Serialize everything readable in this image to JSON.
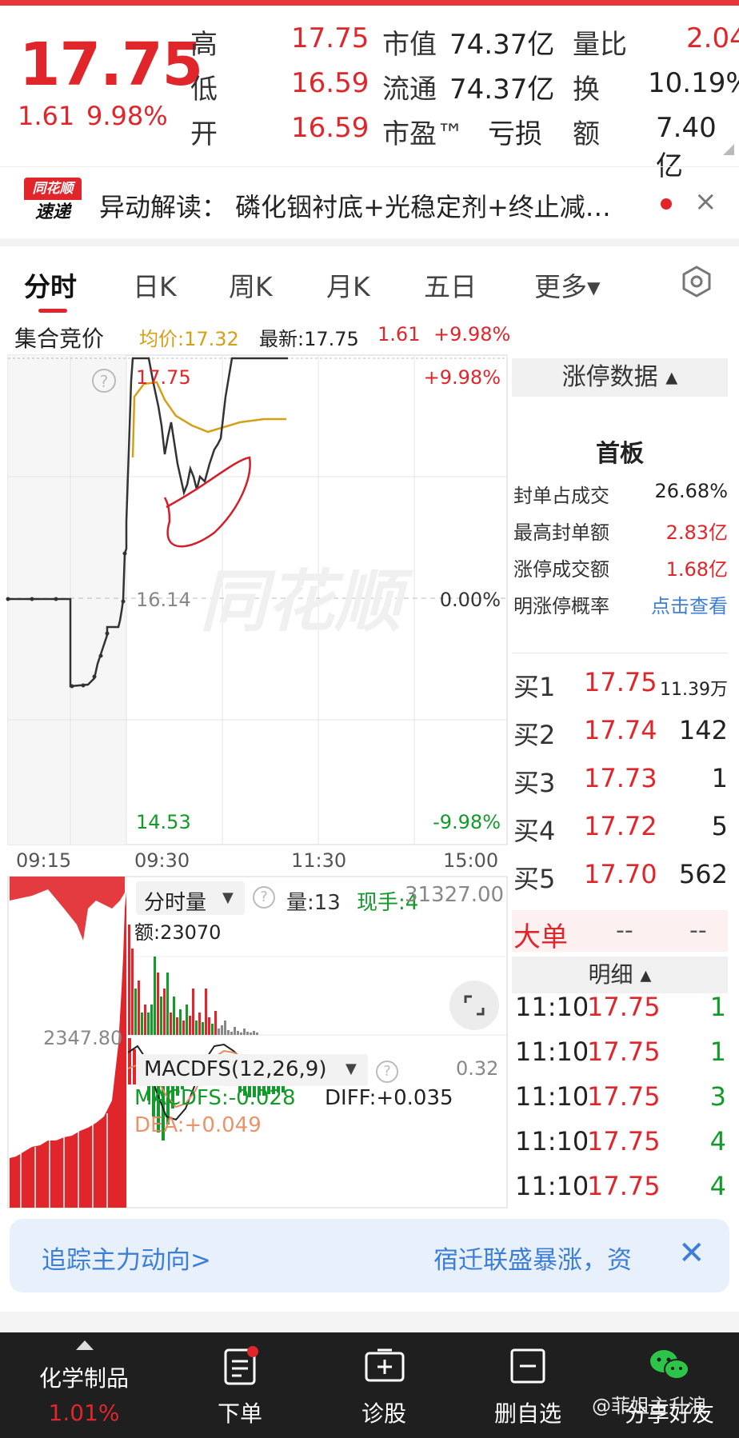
{
  "quote": {
    "price": "17.75",
    "change": "1.61",
    "change_pct": "9.98%",
    "rows": [
      {
        "l1": "高",
        "v1": "17.75",
        "l2": "市值",
        "v2": "74.37亿",
        "l3": "量比",
        "v3": "2.04"
      },
      {
        "l1": "低",
        "v1": "16.59",
        "l2": "流通",
        "v2": "74.37亿",
        "l3": "换",
        "v3": "10.19%"
      },
      {
        "l1": "开",
        "v1": "16.59",
        "l2": "市盈™",
        "v2": "亏损",
        "l3": "额",
        "v3": "7.40亿"
      }
    ]
  },
  "news": {
    "logo_top": "同花顺",
    "logo_bottom": "速递",
    "text": "异动解读：  磷化铟衬底+光稳定剂+终止减…",
    "close": "×"
  },
  "tabs": [
    "分时",
    "日K",
    "周K",
    "月K",
    "五日",
    "更多▾"
  ],
  "chart_info": {
    "auction": "集合竞价",
    "avg": "均价:17.32",
    "latest": "最新:17.75",
    "chg": "1.61",
    "pct": "+9.98%"
  },
  "chart_labels": {
    "top_price": "17.75",
    "top_pct": "+9.98%",
    "mid_price": "16.14",
    "mid_pct": "0.00%",
    "bottom_price": "14.53",
    "bottom_pct": "-9.98%",
    "t1": "09:15",
    "t2": "09:30",
    "t3": "11:30",
    "t4": "15:00",
    "help": "?"
  },
  "volume_panel": {
    "title": "分时量",
    "vol": "量:13",
    "hand": "现手:4",
    "max": "31327.00",
    "amount": "额:23070",
    "left_max": "2347.80"
  },
  "macd_panel": {
    "title": "MACDFS(12,26,9)",
    "value_top": "0.32",
    "macd": "MACDFS:-0.028",
    "diff": "DIFF:+0.035",
    "dea": "DEA:+0.049"
  },
  "limit_data": {
    "title": "涨停数据 ▴",
    "board": "首板",
    "items": [
      {
        "label": "封单占成交",
        "value": "26.68%",
        "color": "#222"
      },
      {
        "label": "最高封单额",
        "value": "2.83亿",
        "color": "#e0262b"
      },
      {
        "label": "涨停成交额",
        "value": "1.68亿",
        "color": "#e0262b"
      },
      {
        "label": "明涨停概率",
        "value": "点击查看",
        "color": "#3d7fd6"
      }
    ]
  },
  "order_book": [
    {
      "label": "买1",
      "price": "17.75",
      "vol": "11.39万"
    },
    {
      "label": "买2",
      "price": "17.74",
      "vol": "142"
    },
    {
      "label": "买3",
      "price": "17.73",
      "vol": "1"
    },
    {
      "label": "买4",
      "price": "17.72",
      "vol": "5"
    },
    {
      "label": "买5",
      "price": "17.70",
      "vol": "562"
    }
  ],
  "big_order": {
    "label": "大单",
    "v1": "--",
    "v2": "--"
  },
  "detail": {
    "title": "明细 ▴",
    "rows": [
      {
        "time": "11:10",
        "price": "17.75",
        "vol": "1"
      },
      {
        "time": "11:10",
        "price": "17.75",
        "vol": "1"
      },
      {
        "time": "11:10",
        "price": "17.75",
        "vol": "3"
      },
      {
        "time": "11:10",
        "price": "17.75",
        "vol": "4"
      },
      {
        "time": "11:10",
        "price": "17.75",
        "vol": "4"
      }
    ]
  },
  "banner": {
    "left": "追踪主力动向>",
    "right": "宿迁联盛暴涨，资",
    "close": "✕"
  },
  "bottom_nav": [
    {
      "label": "化学制品",
      "sub": "1.01%"
    },
    {
      "label": "下单"
    },
    {
      "label": "诊股"
    },
    {
      "label": "删自选"
    },
    {
      "label": "分享好友"
    }
  ],
  "watermark": "同花顺",
  "weibo_mark": "@菲姐主升浪",
  "colors": {
    "red": "#e0262b",
    "green": "#129a2a",
    "blue": "#3d7fd6",
    "avg_line": "#d4a017"
  }
}
